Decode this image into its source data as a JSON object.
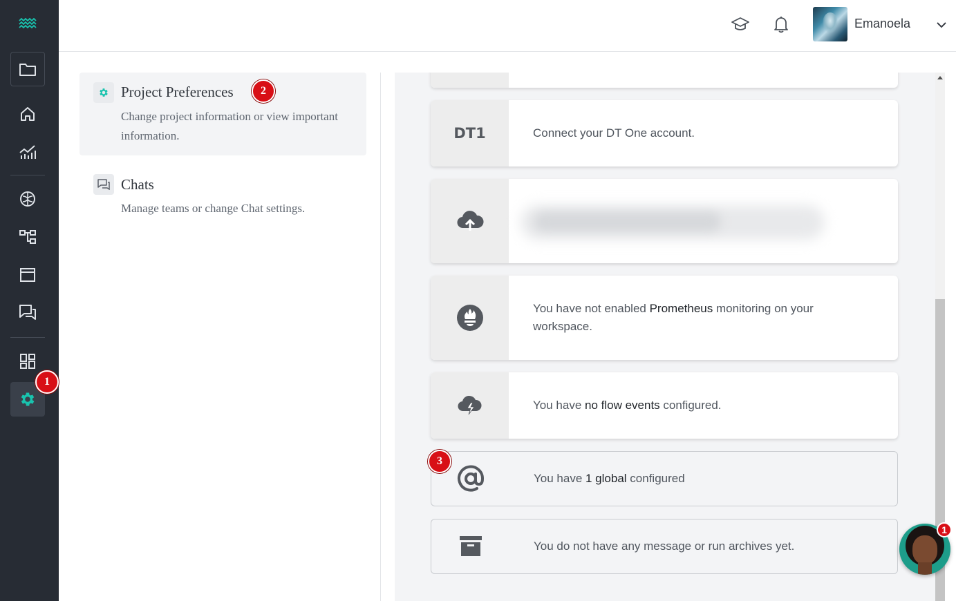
{
  "app": {
    "accent": "#19c3ae"
  },
  "topbar": {
    "icons": [
      "graduation-cap-icon",
      "bell-icon"
    ],
    "user_name": "Emanoela"
  },
  "rail": {
    "items": [
      "folder-icon",
      "home-icon",
      "analytics-icon",
      "brain-icon",
      "flow-icon",
      "window-icon",
      "chats-icon",
      "dashboard-icon",
      "settings-icon"
    ],
    "active": "settings-icon"
  },
  "steps": {
    "one": "1",
    "two": "2",
    "three": "3"
  },
  "menu": {
    "project": {
      "title": "Project Preferences",
      "desc": "Change project information or view important information."
    },
    "chats": {
      "title": "Chats",
      "desc": "Manage teams or change Chat settings."
    }
  },
  "integrations": {
    "dt1": {
      "logo": "DT1",
      "text": "Connect your DT One account."
    },
    "upload": {
      "text": ""
    },
    "prometheus": {
      "pre": "You have not enabled ",
      "bold": "Prometheus",
      "post": " monitoring on your workspace."
    },
    "flow": {
      "pre": "You have ",
      "bold": "no flow events",
      "post": " configured."
    },
    "global": {
      "pre": "You have ",
      "bold": "1 global",
      "post": " configured"
    },
    "archive": {
      "text": "You do not have any message or run archives yet."
    }
  },
  "chat_widget": {
    "unread": "1"
  }
}
